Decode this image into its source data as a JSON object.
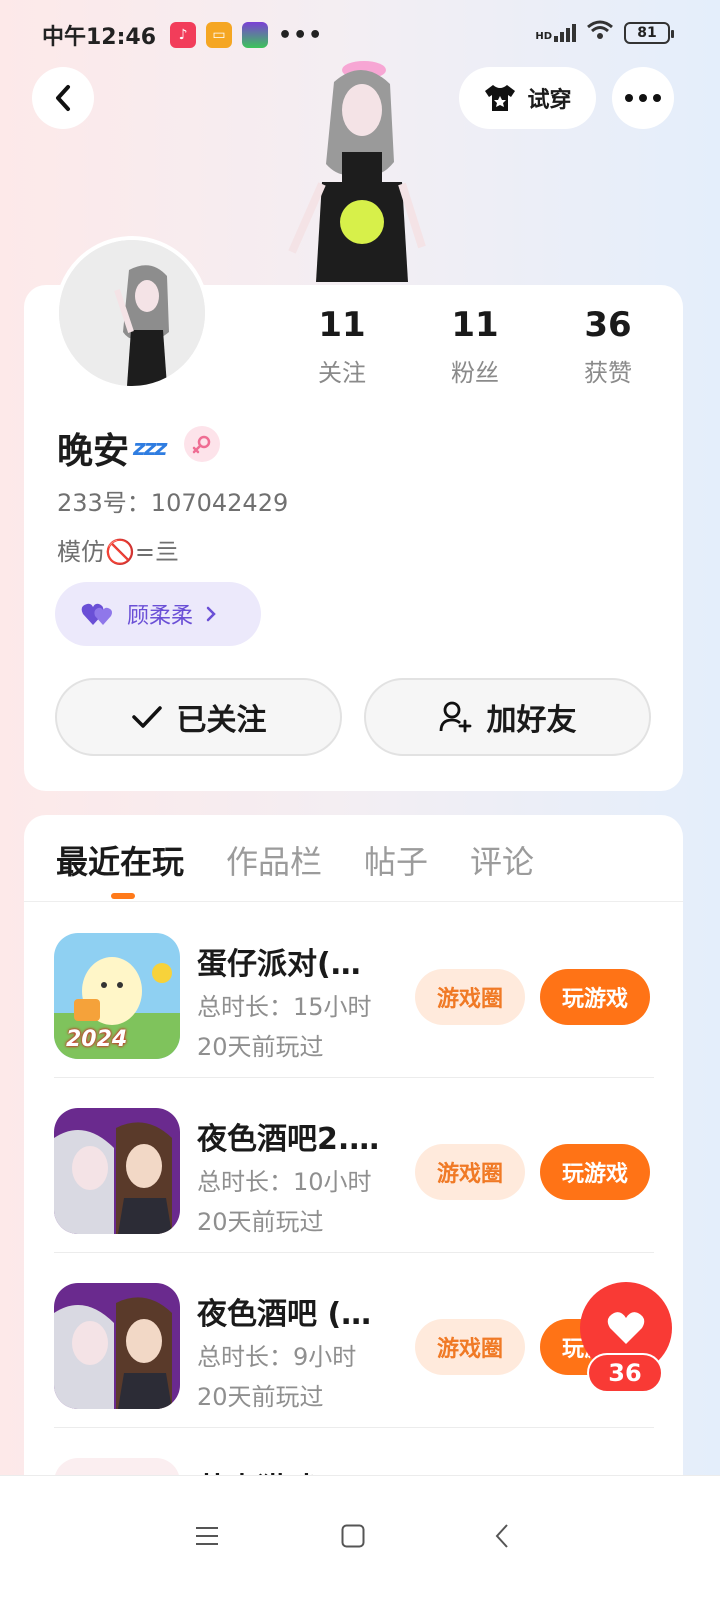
{
  "status_bar": {
    "time": "中午12:46",
    "dots": "•••",
    "network": "HD",
    "battery": "81"
  },
  "header": {
    "tryon_label": "试穿"
  },
  "profile": {
    "stats": [
      {
        "value": "11",
        "label": "关注"
      },
      {
        "value": "11",
        "label": "粉丝"
      },
      {
        "value": "36",
        "label": "获赞"
      }
    ],
    "nickname": "晚安",
    "nickname_emoji": "zzz",
    "uid": "233号：107042429",
    "bio": "模仿🚫=亖",
    "relation_name": "顾柔柔",
    "follow_label": "已关注",
    "add_friend_label": "加好友"
  },
  "tabs": [
    {
      "label": "最近在玩",
      "active": true
    },
    {
      "label": "作品栏",
      "active": false
    },
    {
      "label": "帖子",
      "active": false
    },
    {
      "label": "评论",
      "active": false
    }
  ],
  "games": [
    {
      "title": "蛋仔派对(…",
      "duration": "总时长：15小时",
      "last_played": "20天前玩过",
      "circle_label": "游戏圈",
      "play_label": "玩游戏",
      "icon_text": "2024"
    },
    {
      "title": "夜色酒吧2.…",
      "duration": "总时长：10小时",
      "last_played": "20天前玩过",
      "circle_label": "游戏圈",
      "play_label": "玩游戏"
    },
    {
      "title": "夜色酒吧 (…",
      "duration": "总时长：9小时",
      "last_played": "20天前玩过",
      "circle_label": "游戏圈",
      "play_label": "玩游戏"
    },
    {
      "title": "芒麦猫咪"
    }
  ],
  "like_fab": {
    "count": "36"
  },
  "colors": {
    "accent_orange": "#ff7316",
    "like_red": "#f93a35",
    "relation_purple": "#6a4fd6"
  }
}
